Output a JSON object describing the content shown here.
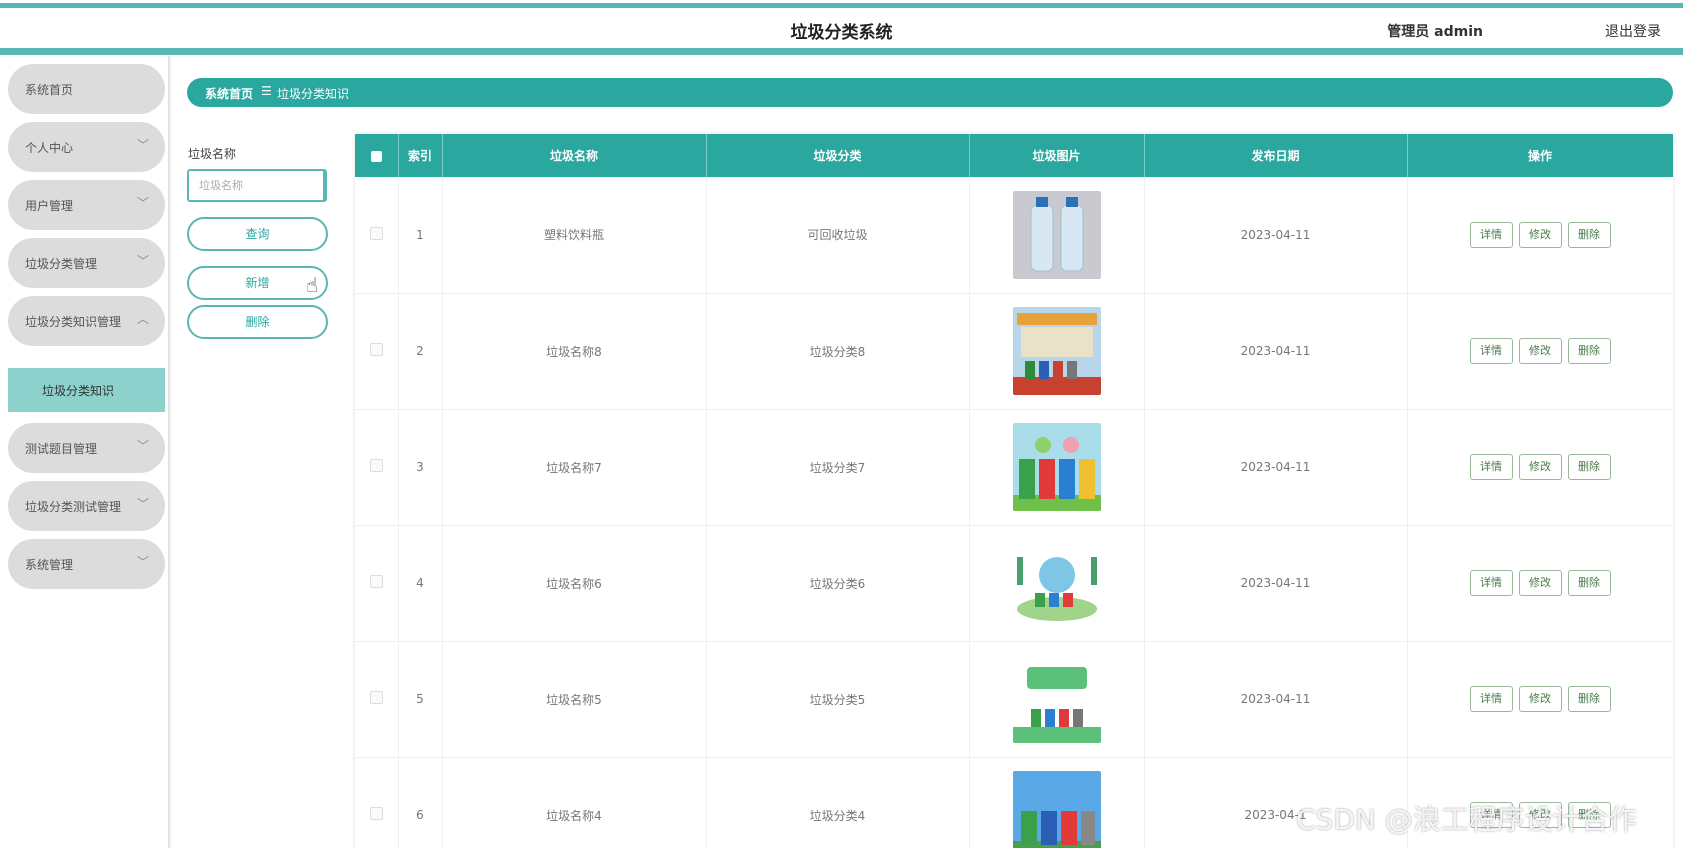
{
  "header": {
    "title": "垃圾分类系统",
    "user": "管理员 admin",
    "logout": "退出登录"
  },
  "sidebar": {
    "items": [
      {
        "label": "系统首页"
      },
      {
        "label": "个人中心"
      },
      {
        "label": "用户管理"
      },
      {
        "label": "垃圾分类管理"
      },
      {
        "label": "垃圾分类知识管理"
      },
      {
        "label": "测试题目管理"
      },
      {
        "label": "垃圾分类测试管理"
      },
      {
        "label": "系统管理"
      }
    ],
    "active_sub": "垃圾分类知识"
  },
  "breadcrumb": {
    "home": "系统首页",
    "separator": "☰",
    "current": "垃圾分类知识"
  },
  "filter": {
    "label": "垃圾名称",
    "placeholder": "垃圾名称",
    "query_btn": "查询",
    "add_btn": "新增",
    "delete_btn": "删除"
  },
  "table": {
    "headers": [
      "索引",
      "垃圾名称",
      "垃圾分类",
      "垃圾图片",
      "发布日期",
      "操作"
    ],
    "actions": {
      "detail": "详情",
      "edit": "修改",
      "delete": "删除"
    },
    "rows": [
      {
        "index": "1",
        "name": "塑料饮料瓶",
        "category": "可回收垃圾",
        "date": "2023-04-11"
      },
      {
        "index": "2",
        "name": "垃圾名称8",
        "category": "垃圾分类8",
        "date": "2023-04-11"
      },
      {
        "index": "3",
        "name": "垃圾名称7",
        "category": "垃圾分类7",
        "date": "2023-04-11"
      },
      {
        "index": "4",
        "name": "垃圾名称6",
        "category": "垃圾分类6",
        "date": "2023-04-11"
      },
      {
        "index": "5",
        "name": "垃圾名称5",
        "category": "垃圾分类5",
        "date": "2023-04-11"
      },
      {
        "index": "6",
        "name": "垃圾名称4",
        "category": "垃圾分类4",
        "date": "2023-04-1"
      }
    ]
  },
  "watermark": "CSDN @浪工程序设计合作"
}
